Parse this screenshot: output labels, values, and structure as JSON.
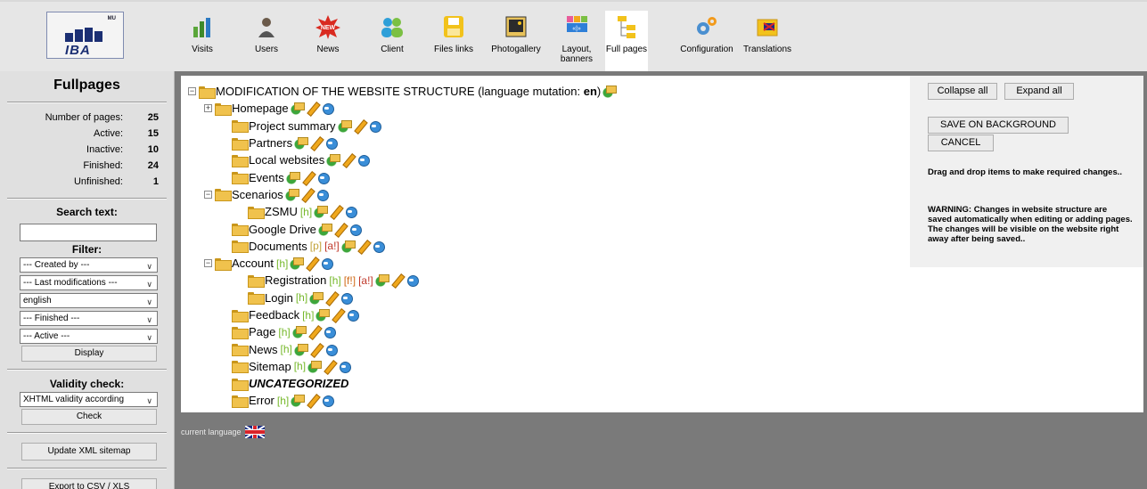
{
  "logo": {
    "small_text": "MU",
    "text": "IBA"
  },
  "toolbar": [
    {
      "label": "Visits",
      "icon": "bar-chart-icon"
    },
    {
      "label": "Users",
      "icon": "user-icon"
    },
    {
      "label": "News",
      "icon": "new-burst-icon"
    },
    {
      "label": "Client",
      "icon": "people-icon"
    },
    {
      "label": "Files links",
      "icon": "floppy-disk-icon"
    },
    {
      "label": "Photogallery",
      "icon": "photo-icon"
    },
    {
      "label": "Layout, banners",
      "icon": "layout-icon"
    },
    {
      "label": "Full pages",
      "icon": "tree-structure-icon"
    },
    {
      "label": "Configuration",
      "icon": "gears-icon"
    },
    {
      "label": "Translations",
      "icon": "flag-folder-icon"
    }
  ],
  "sidebar": {
    "title": "Fullpages",
    "stats": [
      {
        "label": "Number of pages:",
        "value": "25"
      },
      {
        "label": "Active:",
        "value": "15"
      },
      {
        "label": "Inactive:",
        "value": "10"
      },
      {
        "label": "Finished:",
        "value": "24"
      },
      {
        "label": "Unfinished:",
        "value": "1"
      }
    ],
    "search_title": "Search text:",
    "search_value": "",
    "filter_title": "Filter:",
    "filters": [
      "--- Created by ---",
      "--- Last modifications ---",
      "english",
      "--- Finished ---",
      "--- Active ---"
    ],
    "display_button": "Display",
    "validity_title": "Validity check:",
    "validity_select": "XHTML validity according",
    "check_button": "Check",
    "update_xml_button": "Update XML sitemap",
    "export_button": "Export to CSV / XLS"
  },
  "tree": {
    "root_label": "MODIFICATION OF THE WEBSITE STRUCTURE (language mutation: ",
    "root_lang": "en",
    "root_suffix": ")",
    "nodes": [
      {
        "label": "Homepage",
        "toggle": "+",
        "tags": []
      },
      {
        "label": "Project summary",
        "toggle": "",
        "tags": []
      },
      {
        "label": "Partners",
        "toggle": "",
        "tags": []
      },
      {
        "label": "Local websites",
        "toggle": "",
        "tags": []
      },
      {
        "label": "Events",
        "toggle": "",
        "tags": []
      },
      {
        "label": "Scenarios",
        "toggle": "−",
        "tags": []
      },
      {
        "label": "ZSMU",
        "toggle": "",
        "tags": [
          "[h]"
        ]
      },
      {
        "label": "Google Drive",
        "toggle": "",
        "tags": []
      },
      {
        "label": "Documents",
        "toggle": "",
        "tags": [
          "[p]",
          "[a!]"
        ]
      },
      {
        "label": "Account",
        "toggle": "−",
        "tags": [
          "[h]"
        ]
      },
      {
        "label": "Registration",
        "toggle": "",
        "tags": [
          "[h]",
          "[f!]",
          "[a!]"
        ]
      },
      {
        "label": "Login",
        "toggle": "",
        "tags": [
          "[h]"
        ]
      },
      {
        "label": "Feedback",
        "toggle": "",
        "tags": [
          "[h]"
        ]
      },
      {
        "label": "Page",
        "toggle": "",
        "tags": [
          "[h]"
        ]
      },
      {
        "label": "News",
        "toggle": "",
        "tags": [
          "[h]"
        ]
      },
      {
        "label": "Sitemap",
        "toggle": "",
        "tags": [
          "[h]"
        ]
      },
      {
        "label": "UNCATEGORIZED",
        "toggle": "",
        "tags": []
      },
      {
        "label": "Error",
        "toggle": "",
        "tags": [
          "[h]"
        ]
      }
    ]
  },
  "panel": {
    "collapse_all": "Collapse all",
    "expand_all": "Expand all",
    "save_on_background": "SAVE ON BACKGROUND",
    "cancel": "CANCEL",
    "dnd_message": "Drag and drop items to make required changes..",
    "warning": "WARNING: Changes in website structure are saved automatically when editing or adding pages. The changes will be visible on the website right away after being saved.."
  },
  "footer": {
    "current_language": "current language"
  }
}
